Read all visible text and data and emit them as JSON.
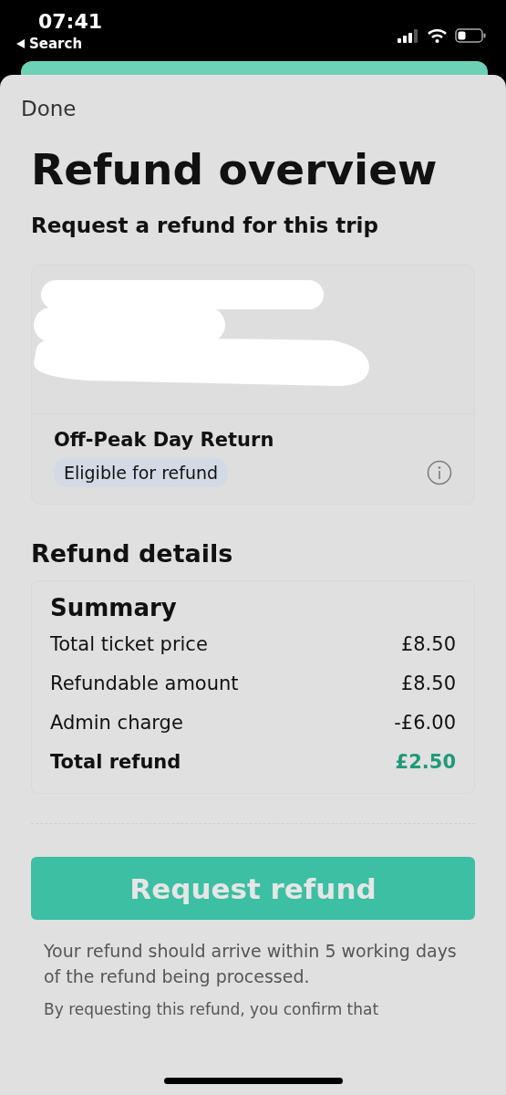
{
  "status_bar": {
    "time": "07:41",
    "back_label": "Search"
  },
  "sheet": {
    "done_label": "Done",
    "title": "Refund overview",
    "subtitle": "Request a refund for this trip"
  },
  "ticket": {
    "name": "Off-Peak Day Return",
    "badge": "Eligible for refund"
  },
  "refund_details": {
    "heading": "Refund details",
    "summary_title": "Summary",
    "rows": [
      {
        "label": "Total ticket price",
        "value": "£8.50",
        "kind": "normal"
      },
      {
        "label": "Refundable amount",
        "value": "£8.50",
        "kind": "normal"
      },
      {
        "label": "Admin charge",
        "value": "-£6.00",
        "kind": "normal"
      },
      {
        "label": "Total refund",
        "value": "£2.50",
        "kind": "total"
      }
    ]
  },
  "action_button": "Request refund",
  "notes": [
    "Your refund should arrive within 5 working days of the refund being processed.",
    "By requesting this refund, you confirm that"
  ]
}
